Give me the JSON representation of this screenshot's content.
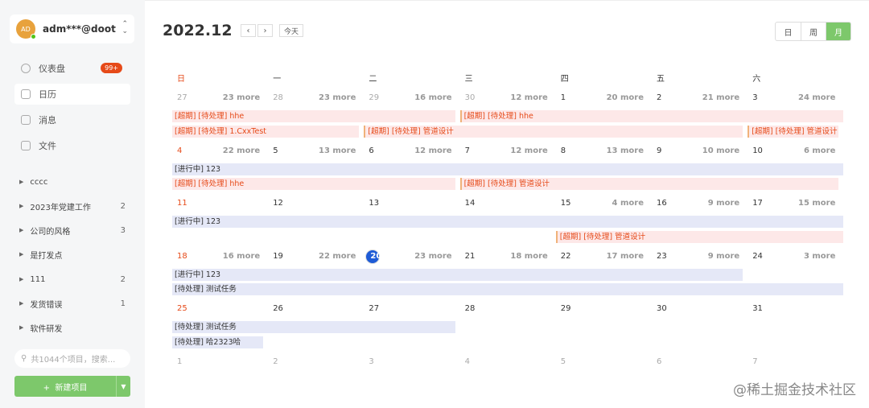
{
  "user": {
    "initials": "AD",
    "name": "adm***@doot..."
  },
  "nav": [
    {
      "label": "仪表盘",
      "badge": "99+",
      "icon": "dashboard-icon"
    },
    {
      "label": "日历",
      "icon": "calendar-icon"
    },
    {
      "label": "消息",
      "icon": "message-icon"
    },
    {
      "label": "文件",
      "icon": "file-icon"
    }
  ],
  "projects": [
    {
      "name": "cccc",
      "count": ""
    },
    {
      "name": "2023年党建工作",
      "count": "2"
    },
    {
      "name": "公司的风格",
      "count": "3"
    },
    {
      "name": "是打发点",
      "count": ""
    },
    {
      "name": "111",
      "count": "2"
    },
    {
      "name": "发货错误",
      "count": "1"
    },
    {
      "name": "软件研发",
      "count": ""
    }
  ],
  "search": {
    "placeholder": "共1044个项目，搜索..."
  },
  "new_button": "新建项目",
  "calendar": {
    "title": "2022.12",
    "prev": "‹",
    "next": "›",
    "today": "今天",
    "views": [
      {
        "label": "日"
      },
      {
        "label": "周"
      },
      {
        "label": "月",
        "active": true
      }
    ],
    "weekdays": [
      "日",
      "一",
      "二",
      "三",
      "四",
      "五",
      "六"
    ],
    "weeks": [
      {
        "days": [
          {
            "n": "27",
            "t": "other",
            "more": "23 more"
          },
          {
            "n": "28",
            "t": "other",
            "more": "23 more"
          },
          {
            "n": "29",
            "t": "other",
            "more": "16 more"
          },
          {
            "n": "30",
            "t": "other",
            "more": "12 more"
          },
          {
            "n": "1",
            "more": "20 more"
          },
          {
            "n": "2",
            "more": "21 more"
          },
          {
            "n": "3",
            "more": "24 more"
          }
        ],
        "events": [
          {
            "text": "[超期] [待处理] hhe",
            "cls": "overdue",
            "start": 0,
            "end": 2.95,
            "row": 0
          },
          {
            "text": "[超期] [待处理] hhe",
            "cls": "overdue bl",
            "start": 3,
            "end": 7,
            "row": 0
          },
          {
            "text": "[超期] [待处理] 1.CxxTest",
            "cls": "overdue",
            "start": 0,
            "end": 1.95,
            "row": 1
          },
          {
            "text": "[超期] [待处理] 管道设计",
            "cls": "overdue bl",
            "start": 2,
            "end": 5.95,
            "row": 1
          },
          {
            "text": "[超期] [待处理] 管道设计",
            "cls": "overdue bl",
            "start": 6,
            "end": 6.95,
            "row": 1
          }
        ]
      },
      {
        "days": [
          {
            "n": "4",
            "more": "22 more"
          },
          {
            "n": "5",
            "more": "13 more"
          },
          {
            "n": "6",
            "more": "12 more"
          },
          {
            "n": "7",
            "more": "12 more"
          },
          {
            "n": "8",
            "more": "13 more"
          },
          {
            "n": "9",
            "more": "10 more"
          },
          {
            "n": "10",
            "more": "6 more"
          }
        ],
        "events": [
          {
            "text": "[进行中] 123",
            "cls": "prog",
            "start": 0,
            "end": 7,
            "row": 0
          },
          {
            "text": "[超期] [待处理] hhe",
            "cls": "overdue",
            "start": 0,
            "end": 2.95,
            "row": 1
          },
          {
            "text": "[超期] [待处理] 管道设计",
            "cls": "overdue bl",
            "start": 3,
            "end": 6.95,
            "row": 1
          }
        ]
      },
      {
        "days": [
          {
            "n": "11",
            "more": ""
          },
          {
            "n": "12",
            "more": ""
          },
          {
            "n": "13",
            "more": ""
          },
          {
            "n": "14",
            "more": ""
          },
          {
            "n": "15",
            "more": "4 more"
          },
          {
            "n": "16",
            "more": "9 more"
          },
          {
            "n": "17",
            "more": "15 more"
          }
        ],
        "events": [
          {
            "text": "[进行中] 123",
            "cls": "prog",
            "start": 0,
            "end": 7,
            "row": 0
          },
          {
            "text": "[超期] [待处理] 管道设计",
            "cls": "overdue bl",
            "start": 4,
            "end": 7,
            "row": 1
          }
        ]
      },
      {
        "days": [
          {
            "n": "18",
            "more": "16 more"
          },
          {
            "n": "19",
            "more": "22 more"
          },
          {
            "n": "20",
            "t": "today",
            "more": "23 more"
          },
          {
            "n": "21",
            "more": "18 more"
          },
          {
            "n": "22",
            "more": "17 more"
          },
          {
            "n": "23",
            "more": "9 more"
          },
          {
            "n": "24",
            "more": "3 more"
          }
        ],
        "events": [
          {
            "text": "[进行中] 123",
            "cls": "prog",
            "start": 0,
            "end": 5.95,
            "row": 0
          },
          {
            "text": "[待处理] 测试任务",
            "cls": "pending",
            "start": 0,
            "end": 7,
            "row": 1
          }
        ]
      },
      {
        "days": [
          {
            "n": "25",
            "more": ""
          },
          {
            "n": "26",
            "more": ""
          },
          {
            "n": "27",
            "more": ""
          },
          {
            "n": "28",
            "more": ""
          },
          {
            "n": "29",
            "more": ""
          },
          {
            "n": "30",
            "more": ""
          },
          {
            "n": "31",
            "more": ""
          }
        ],
        "events": [
          {
            "text": "[待处理] 测试任务",
            "cls": "pending",
            "start": 0,
            "end": 2.95,
            "row": 0
          },
          {
            "text": "[待处理] 哈2323哈",
            "cls": "pending",
            "start": 0,
            "end": 0.95,
            "row": 1
          }
        ]
      },
      {
        "days": [
          {
            "n": "1",
            "t": "other"
          },
          {
            "n": "2",
            "t": "other"
          },
          {
            "n": "3",
            "t": "other"
          },
          {
            "n": "4",
            "t": "other"
          },
          {
            "n": "5",
            "t": "other"
          },
          {
            "n": "6",
            "t": "other"
          },
          {
            "n": "7",
            "t": "other"
          }
        ],
        "events": []
      }
    ]
  },
  "watermark": "@稀土掘金技术社区"
}
